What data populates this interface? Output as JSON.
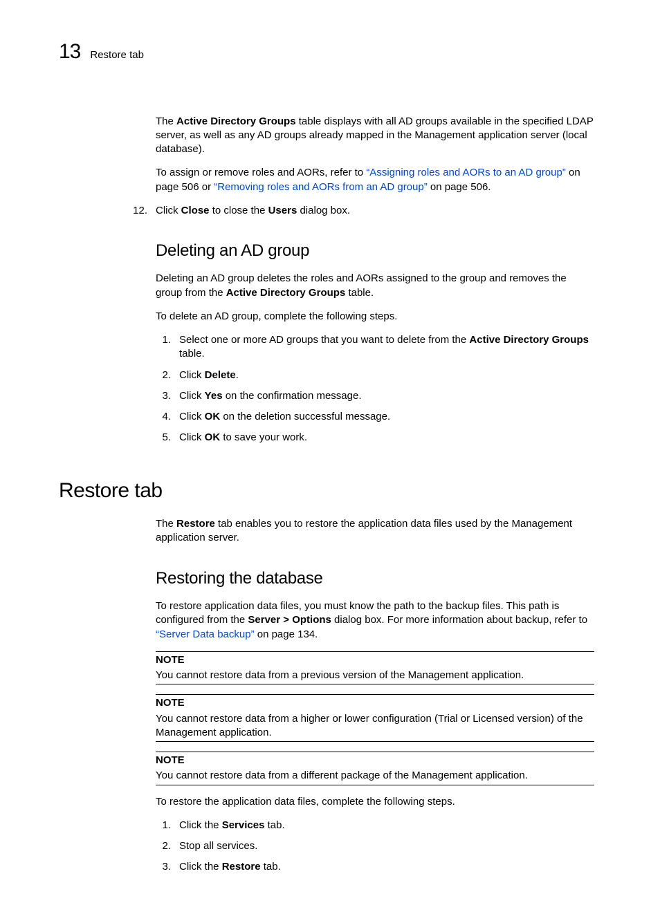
{
  "runningHead": {
    "chapterNum": "13",
    "title": "Restore tab"
  },
  "intro": {
    "p1a": "The ",
    "p1b": "Active Directory Groups",
    "p1c": " table displays with all AD groups available in the specified LDAP server, as well as any AD groups already mapped in the Management application server (local database).",
    "p2a": "To assign or remove roles and AORs, refer to ",
    "link1": "“Assigning roles and AORs to an AD group”",
    "p2b": " on page 506 or ",
    "link2": "“Removing roles and AORs from an AD group”",
    "p2c": " on page 506."
  },
  "step12": {
    "num": "12.",
    "a": "Click ",
    "b": "Close",
    "c": " to close the ",
    "d": "Users",
    "e": " dialog box."
  },
  "sectionDelete": {
    "heading": "Deleting an AD group",
    "p1a": "Deleting an AD group deletes the roles and AORs assigned to the group and removes the group from the ",
    "p1b": "Active Directory Groups",
    "p1c": " table.",
    "p2": "To delete an AD group, complete the following steps.",
    "steps": [
      {
        "num": "1.",
        "parts": [
          "Select one or more AD groups that you want to delete from the ",
          "Active Directory Groups",
          " table."
        ]
      },
      {
        "num": "2.",
        "parts": [
          "Click ",
          "Delete",
          "."
        ]
      },
      {
        "num": "3.",
        "parts": [
          "Click ",
          "Yes",
          " on the confirmation message."
        ]
      },
      {
        "num": "4.",
        "parts": [
          "Click ",
          "OK",
          " on the deletion successful message."
        ]
      },
      {
        "num": "5.",
        "parts": [
          "Click ",
          "OK",
          " to save your work."
        ]
      }
    ]
  },
  "sectionRestore": {
    "heading": "Restore tab",
    "p1a": "The ",
    "p1b": "Restore",
    "p1c": " tab enables you to restore the application data files used by the Management application server."
  },
  "sectionRestoringDb": {
    "heading": "Restoring the database",
    "p1a": "To restore application data files, you must know the path to the backup files. This path is configured from the ",
    "p1b": "Server > Options",
    "p1c": " dialog box. For more information about backup, refer to ",
    "link": "“Server Data backup”",
    "p1d": " on page 134.",
    "noteLabel": "NOTE",
    "notes": [
      "You cannot restore data from a previous version of the Management application.",
      "You cannot restore data from a higher or lower configuration (Trial or Licensed version) of the Management application.",
      "You cannot restore data from a different package of the Management application."
    ],
    "p2": "To restore the application data files, complete the following steps.",
    "steps": [
      {
        "num": "1.",
        "parts": [
          "Click the ",
          "Services",
          " tab."
        ]
      },
      {
        "num": "2.",
        "parts": [
          "Stop all services."
        ]
      },
      {
        "num": "3.",
        "parts": [
          "Click the ",
          "Restore",
          " tab."
        ]
      }
    ]
  }
}
